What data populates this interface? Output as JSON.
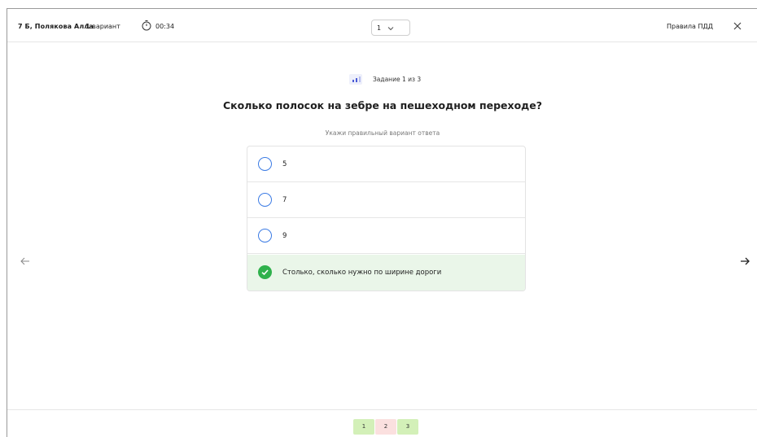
{
  "header": {
    "student": "7 Б, Полякова Алла",
    "variant_number": "1",
    "variant_label": "вариант",
    "timer": "00:34",
    "current_page": "1",
    "test_title": "Правила ПДД"
  },
  "task": {
    "counter": "Задание 1 из 3",
    "question": "Сколько полосок на зебре на пешеходном переходе?",
    "hint": "Укажи правильный вариант ответа",
    "answers": [
      {
        "text": "5",
        "state": "unselected"
      },
      {
        "text": "7",
        "state": "unselected"
      },
      {
        "text": "9",
        "state": "unselected"
      },
      {
        "text": "Столько, сколько нужно по ширине дороги",
        "state": "correct"
      }
    ]
  },
  "pager": {
    "pages": [
      {
        "label": "1",
        "status": "correct"
      },
      {
        "label": "2",
        "status": "incorrect"
      },
      {
        "label": "3",
        "status": "correct"
      }
    ]
  },
  "colors": {
    "accent_blue": "#3b7be4",
    "correct_green": "#2fb14c",
    "correct_bg": "#eaf6e9",
    "page_ok": "#d3f0b8",
    "page_bad": "#fbe0df"
  },
  "icons": {
    "timer": "stopwatch-icon",
    "close": "close-icon",
    "prev": "arrow-left-icon",
    "next": "arrow-right-icon",
    "task": "bar-chart-icon",
    "check": "check-circle-icon",
    "select": "chevron-down-icon"
  }
}
